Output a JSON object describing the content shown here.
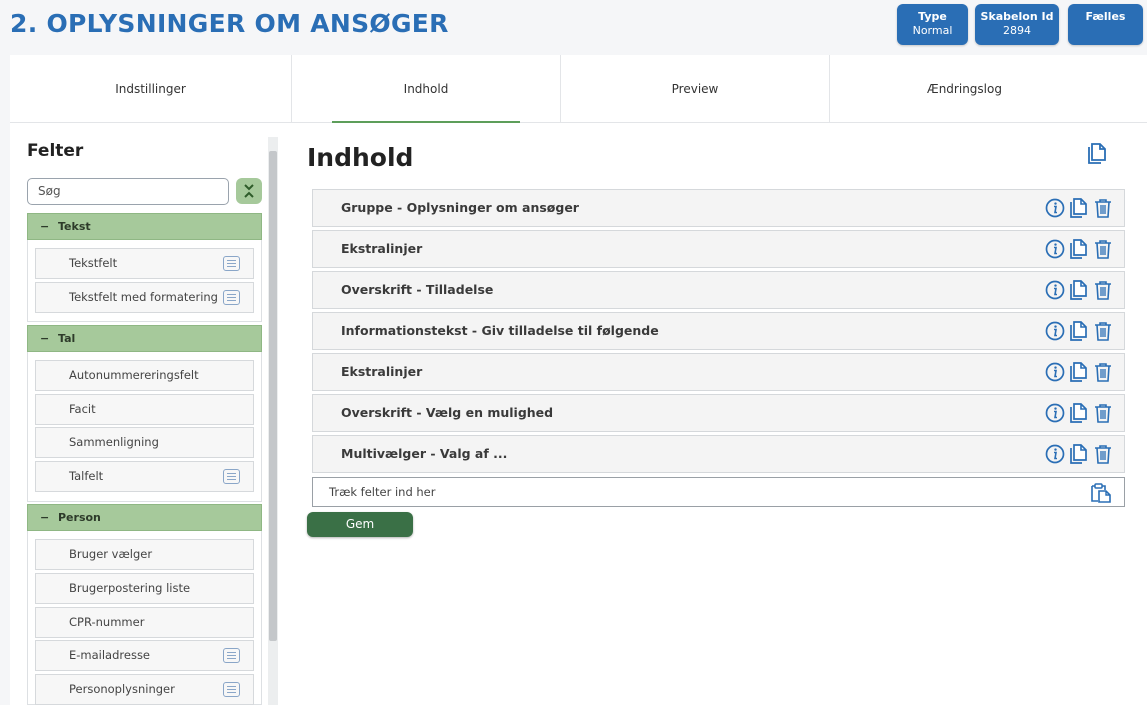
{
  "page": {
    "title": "2. OPLYSNINGER OM ANSØGER"
  },
  "badges": [
    {
      "title": "Type",
      "value": "Normal"
    },
    {
      "title": "Skabelon Id",
      "value": "2894"
    },
    {
      "title": "Fælles",
      "value": ""
    }
  ],
  "tabs": [
    {
      "label": "Indstillinger"
    },
    {
      "label": "Indhold",
      "active": true
    },
    {
      "label": "Preview"
    },
    {
      "label": "Ændringslog"
    }
  ],
  "sidebar": {
    "title": "Felter",
    "search_placeholder": "Søg",
    "collapse_icon": "collapse-icon",
    "groups": [
      {
        "label": "Tekst",
        "fields": [
          {
            "label": "Tekstfelt",
            "has_list_icon": true
          },
          {
            "label": "Tekstfelt med formatering",
            "has_list_icon": true
          }
        ]
      },
      {
        "label": "Tal",
        "fields": [
          {
            "label": "Autonummereringsfelt",
            "has_list_icon": false
          },
          {
            "label": "Facit",
            "has_list_icon": false
          },
          {
            "label": "Sammenligning",
            "has_list_icon": false
          },
          {
            "label": "Talfelt",
            "has_list_icon": true
          }
        ]
      },
      {
        "label": "Person",
        "fields": [
          {
            "label": "Bruger vælger",
            "has_list_icon": false
          },
          {
            "label": "Brugerpostering liste",
            "has_list_icon": false
          },
          {
            "label": "CPR-nummer",
            "has_list_icon": false
          },
          {
            "label": "E-mailadresse",
            "has_list_icon": true
          },
          {
            "label": "Personoplysninger",
            "has_list_icon": true
          }
        ]
      }
    ]
  },
  "content": {
    "title": "Indhold",
    "rows": [
      {
        "label": "Gruppe - Oplysninger om ansøger"
      },
      {
        "label": "Ekstralinjer"
      },
      {
        "label": "Overskrift - Tilladelse"
      },
      {
        "label": "Informationstekst - Giv tilladelse til følgende"
      },
      {
        "label": "Ekstralinjer"
      },
      {
        "label": "Overskrift - Vælg en mulighed"
      },
      {
        "label": "Multivælger - Valg af ..."
      }
    ],
    "drop_label": "Træk felter ind her",
    "save_label": "Gem"
  },
  "colors": {
    "accent": "#2a6eb5",
    "group_green": "#a6c99b",
    "save_green": "#3a7046",
    "tab_underline": "#5d9e5a"
  }
}
